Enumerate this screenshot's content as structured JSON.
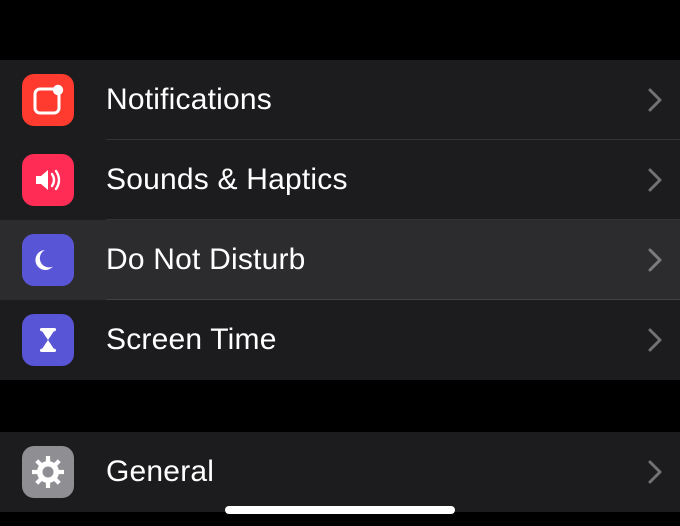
{
  "colors": {
    "red": "#ff3b30",
    "pink": "#ff2d55",
    "indigo": "#5856d6",
    "gray": "#8e8e93"
  },
  "group1": {
    "notifications": {
      "label": "Notifications"
    },
    "sounds": {
      "label": "Sounds & Haptics"
    },
    "dnd": {
      "label": "Do Not Disturb"
    },
    "screentime": {
      "label": "Screen Time"
    }
  },
  "group2": {
    "general": {
      "label": "General"
    }
  }
}
